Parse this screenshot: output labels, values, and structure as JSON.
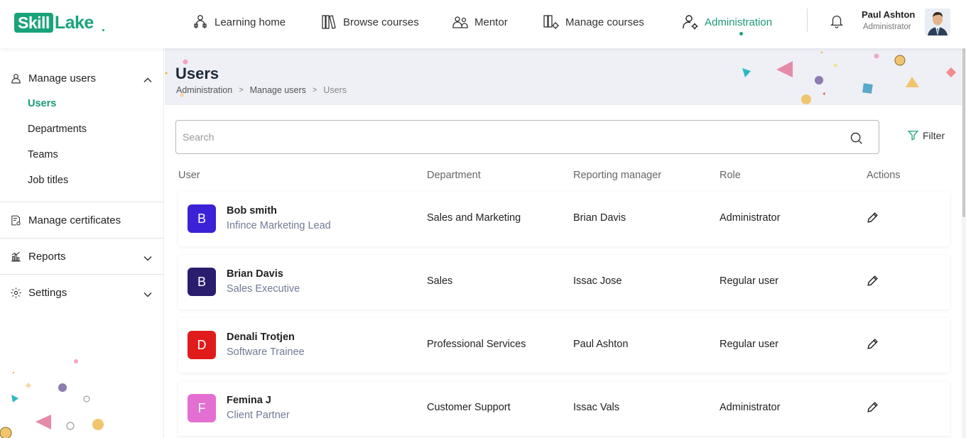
{
  "brand": {
    "logo_box": "Skill",
    "logo_rest": "Lake"
  },
  "nav": [
    {
      "label": "Learning home",
      "icon": "learning-home-icon"
    },
    {
      "label": "Browse courses",
      "icon": "books-icon"
    },
    {
      "label": "Mentor",
      "icon": "mentor-icon"
    },
    {
      "label": "Manage courses",
      "icon": "manage-courses-icon"
    },
    {
      "label": "Administration",
      "icon": "admin-user-gear-icon",
      "active": true
    }
  ],
  "profile": {
    "name": "Paul Ashton",
    "role": "Administrator"
  },
  "sidebar": {
    "manage_users": {
      "label": "Manage users",
      "expanded": true,
      "items": [
        {
          "label": "Users",
          "active": true
        },
        {
          "label": "Departments"
        },
        {
          "label": "Teams"
        },
        {
          "label": "Job titles"
        }
      ]
    },
    "manage_certificates": {
      "label": "Manage certificates"
    },
    "reports": {
      "label": "Reports"
    },
    "settings": {
      "label": "Settings"
    }
  },
  "page": {
    "title": "Users",
    "breadcrumb": [
      "Administration",
      "Manage users",
      "Users"
    ]
  },
  "search": {
    "placeholder": "Search",
    "value": ""
  },
  "filter_label": "Filter",
  "table": {
    "headers": [
      "User",
      "Department",
      "Reporting manager",
      "Role",
      "Actions"
    ],
    "rows": [
      {
        "initial": "B",
        "color": "#3b22d6",
        "name": "Bob smith",
        "title": "Infince Marketing Lead",
        "department": "Sales and Marketing",
        "manager": "Brian Davis",
        "role": "Administrator"
      },
      {
        "initial": "B",
        "color": "#2b1d6e",
        "name": "Brian Davis",
        "title": "Sales Executive",
        "department": "Sales",
        "manager": "Issac Jose",
        "role": "Regular user"
      },
      {
        "initial": "D",
        "color": "#e01b1b",
        "name": "Denali Trotjen",
        "title": "Software Trainee",
        "department": "Professional Services",
        "manager": "Paul Ashton",
        "role": "Regular user"
      },
      {
        "initial": "F",
        "color": "#e46fd3",
        "name": "Femina J",
        "title": "Client Partner",
        "department": "Customer Support",
        "manager": "Issac Vals",
        "role": "Administrator"
      }
    ]
  },
  "colors": {
    "accent": "#1aa37a",
    "banner": "#eef0f6"
  }
}
